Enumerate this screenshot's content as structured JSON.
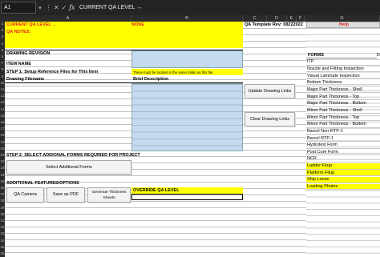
{
  "formula_bar": {
    "name_box": "A1",
    "icons": [
      "more-icon",
      "cancel-icon",
      "confirm-icon"
    ],
    "fx": "fx",
    "value": "CURRENT QA LEVEL →"
  },
  "columns": [
    "A",
    "B",
    "C",
    "D",
    "E",
    "F",
    "G"
  ],
  "rows": [
    "1",
    "2",
    "3",
    "4",
    "5",
    "6",
    "7",
    "8",
    "9",
    "10",
    "11",
    "12",
    "13",
    "14",
    "15",
    "16",
    "17",
    "18",
    "19",
    "20",
    "21",
    "22",
    "23",
    "24",
    "25",
    "26",
    "27",
    "28",
    "29",
    "30",
    "31",
    "32",
    "33",
    "34",
    "35",
    "36"
  ],
  "sheet": {
    "current_qa_label": "CURRENT QA LEVEL →",
    "current_qa_value": "NONE",
    "template_rev": "QA Template Rev: 08222022",
    "help_label": "Help",
    "qa_notes": "QA NOTES:",
    "drawing_revision": "DRAWING REVISION",
    "item_name": "ITEM NAME",
    "step1": "STEP 1:  Setup Reference Files for This Item",
    "same_folder_note": "These must be located in the same folder as this file.",
    "drawing_filename": "Drawing Filename",
    "brief_description": "Brief Description",
    "step2": "STEP 2:  SELECT ADDIONAL FORMS REQUIRED FOR PROJECT",
    "additional_features": "ADDITIONAL FEATURES/OPTIONS",
    "override_qa_level": "OVERRIDE QA LEVEL"
  },
  "buttons": {
    "update_drawing_links": "Update Drawing Links",
    "clear_drawing_links": "Clear Drawing Links",
    "select_additional_forms": "Select Additional Forms",
    "qa_camera": "QA Camera",
    "save_as_pdf": "Save as PDF",
    "generate_thickness_sheets": "Generate Thickness Sheets"
  },
  "forms": {
    "header": "FORMS",
    "col_h": "D",
    "items": [
      {
        "label": "ITP",
        "highlight": false
      },
      {
        "label": "Nozzle and Fitting Inspection",
        "highlight": false
      },
      {
        "label": "Visual Laminate Inspection",
        "highlight": false
      },
      {
        "label": "Bottom Thickness",
        "highlight": false
      },
      {
        "label": "Major Part Thickness - Shell",
        "highlight": false
      },
      {
        "label": "Major Part Thickness - Top",
        "highlight": false
      },
      {
        "label": "Major Part Thickness - Bottom",
        "highlight": false
      },
      {
        "label": "Minor Part Thickness - Shell",
        "highlight": false
      },
      {
        "label": "Minor Part Thickness - Top",
        "highlight": false
      },
      {
        "label": "Minor Part Thickness - Bottom",
        "highlight": false
      },
      {
        "label": "Barcol Non-RTP-1",
        "highlight": false
      },
      {
        "label": "Barcol RTP-1",
        "highlight": false
      },
      {
        "label": "Hydrotest Form",
        "highlight": false
      },
      {
        "label": "Post Cure Form",
        "highlight": false
      },
      {
        "label": "NCR",
        "highlight": false
      },
      {
        "label": "Ladder Fitup",
        "highlight": true
      },
      {
        "label": "Platform Fitup",
        "highlight": true
      },
      {
        "label": "Ship Loose",
        "highlight": true
      },
      {
        "label": "Loading Photos",
        "highlight": true
      }
    ]
  },
  "colors": {
    "yellow": "#ffff00",
    "blue_input": "#c5d9f1",
    "red_text": "#e02020",
    "header_dark": "#2b2b2b"
  }
}
